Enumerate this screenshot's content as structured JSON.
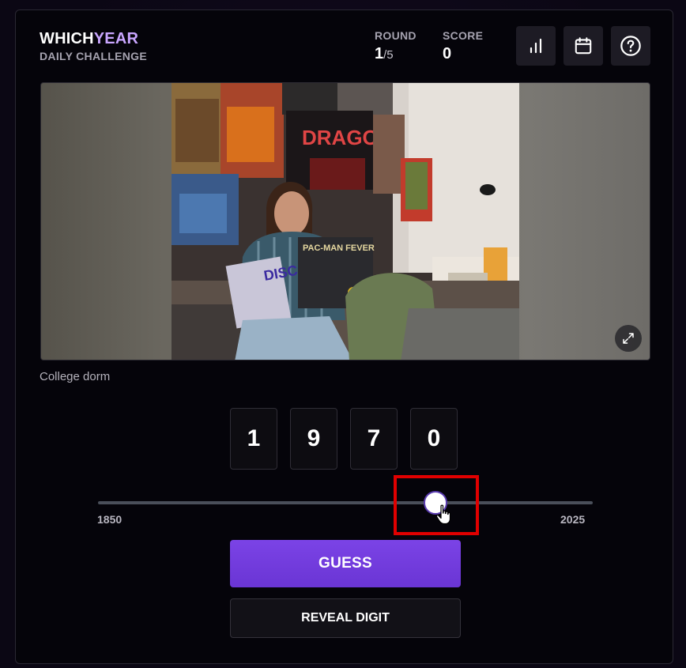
{
  "header": {
    "logo_part1": "WHICH",
    "logo_part2": "YEAR",
    "subtitle": "DAILY CHALLENGE",
    "round_label": "ROUND",
    "round_current": "1",
    "round_total": "/5",
    "score_label": "SCORE",
    "score_value": "0",
    "icons": [
      "bar-chart-icon",
      "calendar-icon",
      "help-icon"
    ]
  },
  "photo": {
    "caption": "College dorm",
    "poster_text_dragon": "DRAGON",
    "record_text_1": "DISCO",
    "record_text_2": "PAC-MAN FEVER"
  },
  "guess": {
    "digits": [
      "1",
      "9",
      "7",
      "0"
    ],
    "slider_min": "1850",
    "slider_max": "2025",
    "slider_value": 1970
  },
  "buttons": {
    "guess_label": "GUESS",
    "reveal_label": "REVEAL DIGIT"
  },
  "colors": {
    "accent": "#c9a6ff",
    "primary": "#6d38d8",
    "highlight": "#e00000"
  }
}
